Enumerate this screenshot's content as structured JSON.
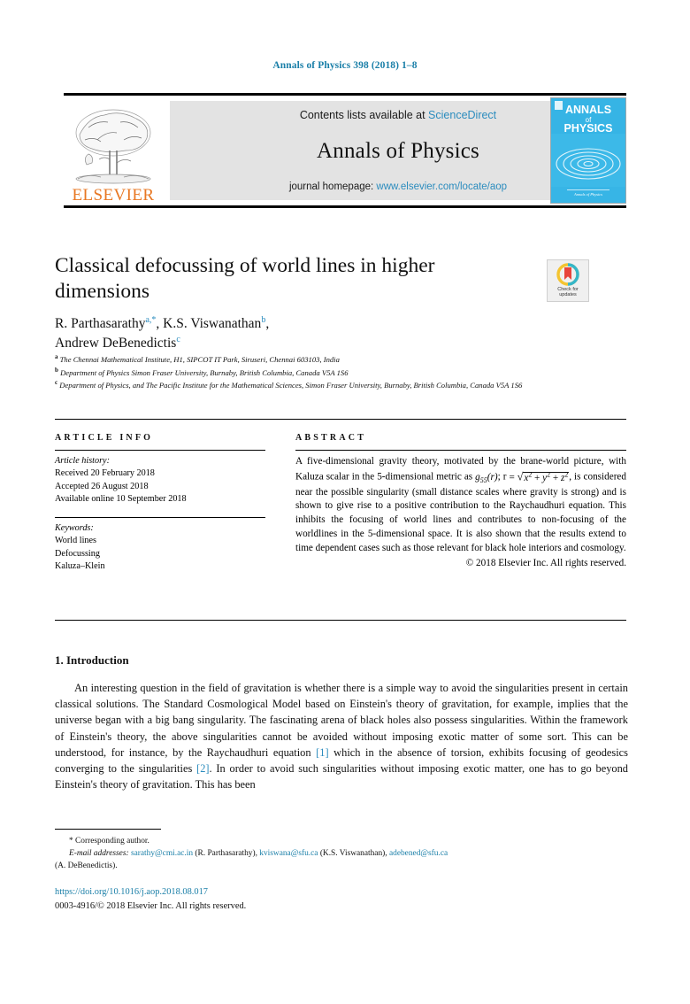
{
  "running_head": "Annals of Physics 398 (2018) 1–8",
  "masthead": {
    "publisher_logo_alt": "elsevier-tree-logo",
    "publisher_name": "ELSEVIER",
    "contents_prefix": "Contents lists available at ",
    "contents_link": "ScienceDirect",
    "journal_title": "Annals of Physics",
    "homepage_prefix": "journal homepage: ",
    "homepage_url": "www.elsevier.com/locate/aop",
    "cover": {
      "line1": "ANNALS",
      "line2": "of",
      "line3": "PHYSICS",
      "footer": "Annals of Physics",
      "bg_color": "#3cb9e8"
    }
  },
  "article": {
    "title": "Classical defocussing of world lines in higher dimensions",
    "crossmark": {
      "line1": "Check for",
      "line2": "updates"
    },
    "authors_html": "R. Parthasarathy <sup>a,*</sup>, K.S. Viswanathan <sup>b</sup>, Andrew DeBenedictis <sup>c</sup>",
    "authors": [
      {
        "name": "R. Parthasarathy",
        "marks": "a,*"
      },
      {
        "name": "K.S. Viswanathan",
        "marks": "b"
      },
      {
        "name": "Andrew DeBenedictis",
        "marks": "c"
      }
    ],
    "affiliations": [
      {
        "mark": "a",
        "text": "The Chennai Mathematical Institute, H1, SIPCOT IT Park, Siruseri, Chennai 603103, India"
      },
      {
        "mark": "b",
        "text": "Department of Physics Simon Fraser University, Burnaby, British Columbia, Canada V5A 1S6"
      },
      {
        "mark": "c",
        "text": "Department of Physics, and The Pacific Institute for the Mathematical Sciences, Simon Fraser University, Burnaby, British Columbia, Canada V5A 1S6"
      }
    ]
  },
  "article_info": {
    "heading": "ARTICLE INFO",
    "history_label": "Article history:",
    "history": [
      "Received 20 February 2018",
      "Accepted 26 August 2018",
      "Available online 10 September 2018"
    ],
    "keywords_label": "Keywords:",
    "keywords": [
      "World lines",
      "Defocussing",
      "Kaluza–Klein"
    ]
  },
  "abstract": {
    "heading": "ABSTRACT",
    "part1": "A five-dimensional gravity theory, motivated by the brane-world picture, with Kaluza scalar in the 5-dimensional metric as ",
    "metric": "g55(r)",
    "part2": "; r ",
    "eq_lead": "= ",
    "radicand": "x² + y² + z²",
    "part3": ", is considered near the possible singularity (small distance scales where gravity is strong) and is shown to give rise to a positive contribution to the Raychaudhuri equation. This inhibits the focusing of world lines and contributes to non-focusing of the worldlines in the 5-dimensional space. It is also shown that the results extend to time dependent cases such as those relevant for black hole interiors and cosmology.",
    "copyright": "© 2018 Elsevier Inc. All rights reserved."
  },
  "body": {
    "section_number": "1.",
    "section_title": "Introduction",
    "paragraph_1_a": "An interesting question in the field of gravitation is whether there is a simple way to avoid the singularities present in certain classical solutions. The Standard Cosmological Model based on Einstein's theory of gravitation, for example, implies that the universe began with a big bang singularity. The fascinating arena of black holes also possess singularities. Within the framework of Einstein's theory, the above singularities cannot be avoided without imposing exotic matter of some sort. This can be understood, for instance, by the Raychaudhuri equation ",
    "ref_1": "[1]",
    "paragraph_1_b": " which in the absence of torsion, exhibits focusing of geodesics converging to the singularities ",
    "ref_2": "[2]",
    "paragraph_1_c": ". In order to avoid such singularities without imposing exotic matter, one has to go beyond Einstein's theory of gravitation. This has been"
  },
  "footnotes": {
    "corresponding": "* Corresponding author.",
    "email_label": "E-mail addresses:",
    "emails": [
      {
        "address": "sarathy@cmi.ac.in",
        "owner": "(R. Parthasarathy)"
      },
      {
        "address": "kviswana@sfu.ca",
        "owner": "(K.S. Viswanathan)"
      },
      {
        "address": "adebened@sfu.ca",
        "owner": "(A. DeBenedictis)"
      }
    ],
    "emails_line1": "sarathy@cmi.ac.in (R. Parthasarathy), kviswana@sfu.ca (K.S. Viswanathan), adebened@sfu.ca",
    "emails_line2": "(A. DeBenedictis)."
  },
  "footer": {
    "doi": "https://doi.org/10.1016/j.aop.2018.08.017",
    "issn_line": "0003-4916/© 2018 Elsevier Inc. All rights reserved."
  },
  "colors": {
    "link": "#1a7fa8",
    "sciencedirect": "#2b8cbe",
    "elsevier_orange": "#e87722",
    "cover_blue": "#3cb9e8"
  }
}
